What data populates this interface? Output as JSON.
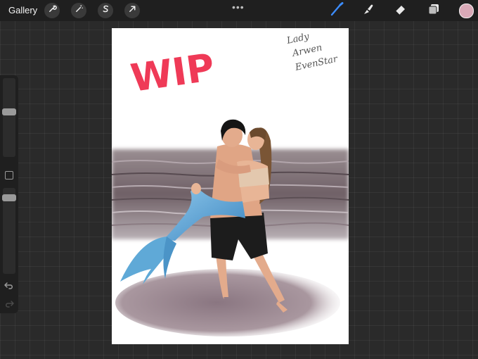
{
  "topbar": {
    "gallery_label": "Gallery",
    "actions": [
      {
        "icon": "wrench-icon"
      },
      {
        "icon": "magic-wand-icon"
      },
      {
        "icon": "selection-s-icon"
      },
      {
        "icon": "arrow-cursor-icon"
      }
    ],
    "menu_dots": "•••",
    "tools": [
      {
        "icon": "brush-icon",
        "active": true
      },
      {
        "icon": "smudge-icon",
        "active": false
      },
      {
        "icon": "eraser-icon",
        "active": false
      },
      {
        "icon": "layers-icon",
        "active": false
      }
    ],
    "current_color": "#d9a9b7"
  },
  "sidebar": {
    "brush_size_level": 0.58,
    "opacity_level": 0.92
  },
  "artwork": {
    "wip_text": "WIP",
    "signature_lines": [
      "Lady",
      "Arwen",
      "EvenStar"
    ],
    "colors": {
      "wip": "#ef3a57",
      "sea": "#7d6e74",
      "tail": "#5fa9d7",
      "shorts": "#1c1c1c",
      "shadow": "#8f7d86"
    }
  }
}
